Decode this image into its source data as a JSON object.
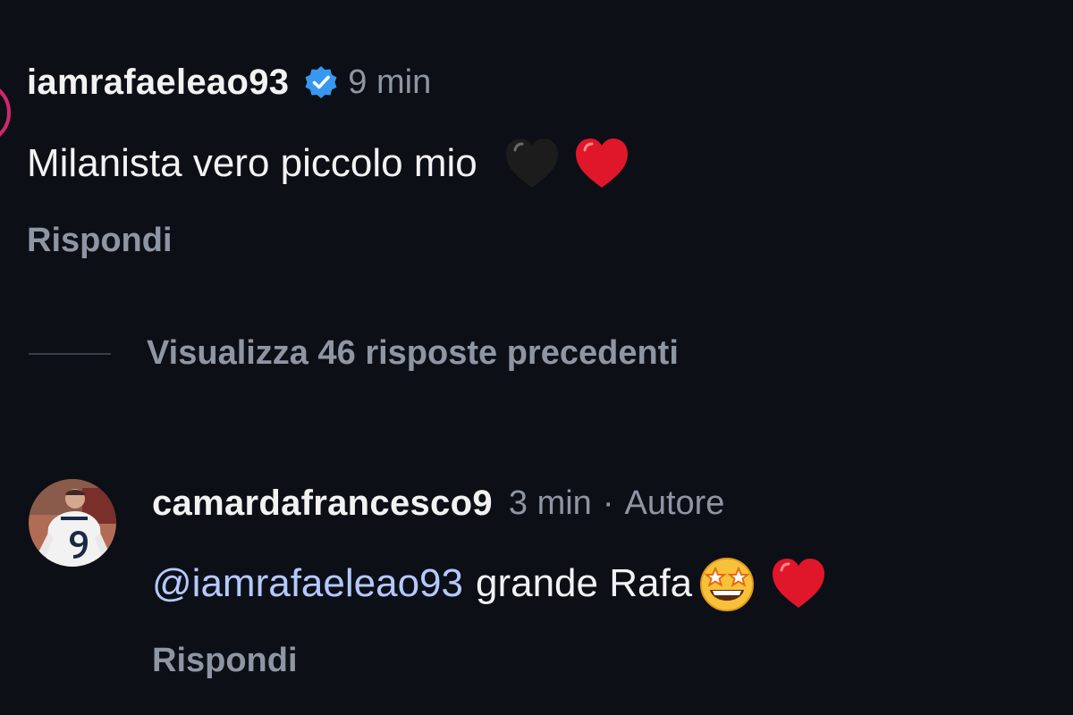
{
  "comments": [
    {
      "username": "iamrafaeleao93",
      "verified": true,
      "time": "9 min",
      "text": "Milanista vero piccolo mio",
      "emojis": [
        "black-heart",
        "red-heart"
      ],
      "reply_label": "Rispondi"
    },
    {
      "username": "camardafrancesco9",
      "time": "3 min",
      "separator": "·",
      "author_label": "Autore",
      "mention": "@iamrafaeleao93",
      "text": "grande Rafa",
      "emojis": [
        "star-struck-face",
        "red-heart"
      ],
      "reply_label": "Rispondi"
    }
  ],
  "view_replies": {
    "label": "Visualizza 46 risposte precedenti"
  },
  "colors": {
    "background": "#0c0f16",
    "mention": "#b4c9ff",
    "muted": "#8e96a3",
    "verified": "#3897f0",
    "heart_red": "#e0162b"
  }
}
